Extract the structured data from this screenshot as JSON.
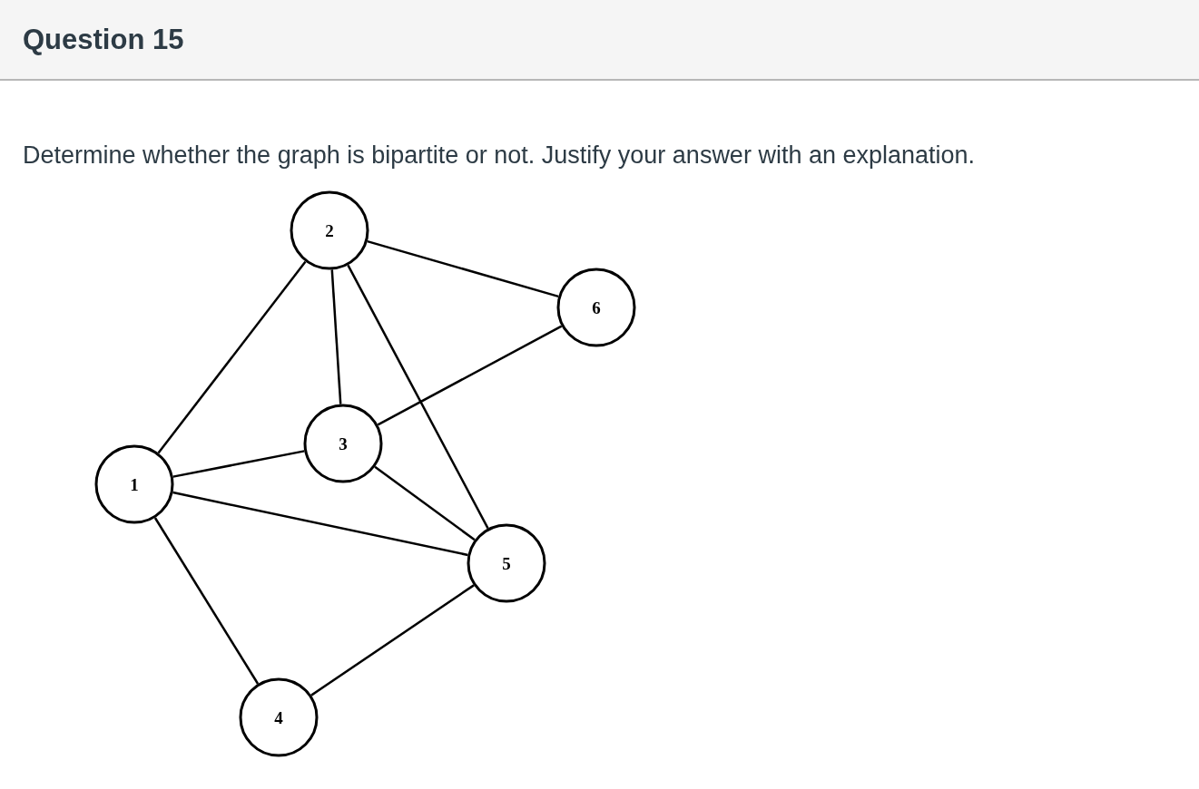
{
  "header": {
    "title": "Question 15"
  },
  "question": {
    "text": "Determine whether the graph is bipartite or not. Justify your answer with an explanation."
  },
  "graph": {
    "nodes": [
      {
        "label": "1"
      },
      {
        "label": "2"
      },
      {
        "label": "3"
      },
      {
        "label": "4"
      },
      {
        "label": "5"
      },
      {
        "label": "6"
      }
    ]
  }
}
